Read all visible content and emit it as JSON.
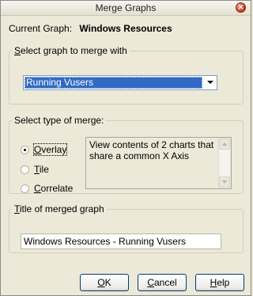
{
  "window": {
    "title": "Merge Graphs",
    "close_glyph": "✕"
  },
  "current_graph": {
    "label": "Current Graph:",
    "value": "Windows Resources"
  },
  "merge_with": {
    "legend_underlined": "S",
    "legend_rest": "elect graph to merge with",
    "selected": "Running Vusers"
  },
  "merge_type": {
    "legend": "Select type of merge:",
    "options": [
      {
        "underlined": "O",
        "rest": "verlay",
        "checked": true
      },
      {
        "underlined": "T",
        "rest": "ile",
        "checked": false
      },
      {
        "underlined": "C",
        "rest": "orrelate",
        "checked": false
      }
    ],
    "description": "View contents of 2 charts that share a common X Axis"
  },
  "merged_title": {
    "legend_underlined": "T",
    "legend_rest": "itle of merged graph",
    "value": "Windows Resources - Running Vusers"
  },
  "buttons": {
    "ok_underlined": "O",
    "ok_rest": "K",
    "cancel_underlined": "C",
    "cancel_rest": "ancel",
    "help_underlined": "H",
    "help_rest": "elp"
  },
  "icons": {
    "close": "close-icon",
    "dropdown": "chevron-down-icon",
    "scroll_up": "scroll-up-icon",
    "scroll_down": "scroll-down-icon"
  },
  "colors": {
    "dialog_bg": "#ece9d8",
    "selection": "#316ac5",
    "close_button": "#c0371a"
  }
}
